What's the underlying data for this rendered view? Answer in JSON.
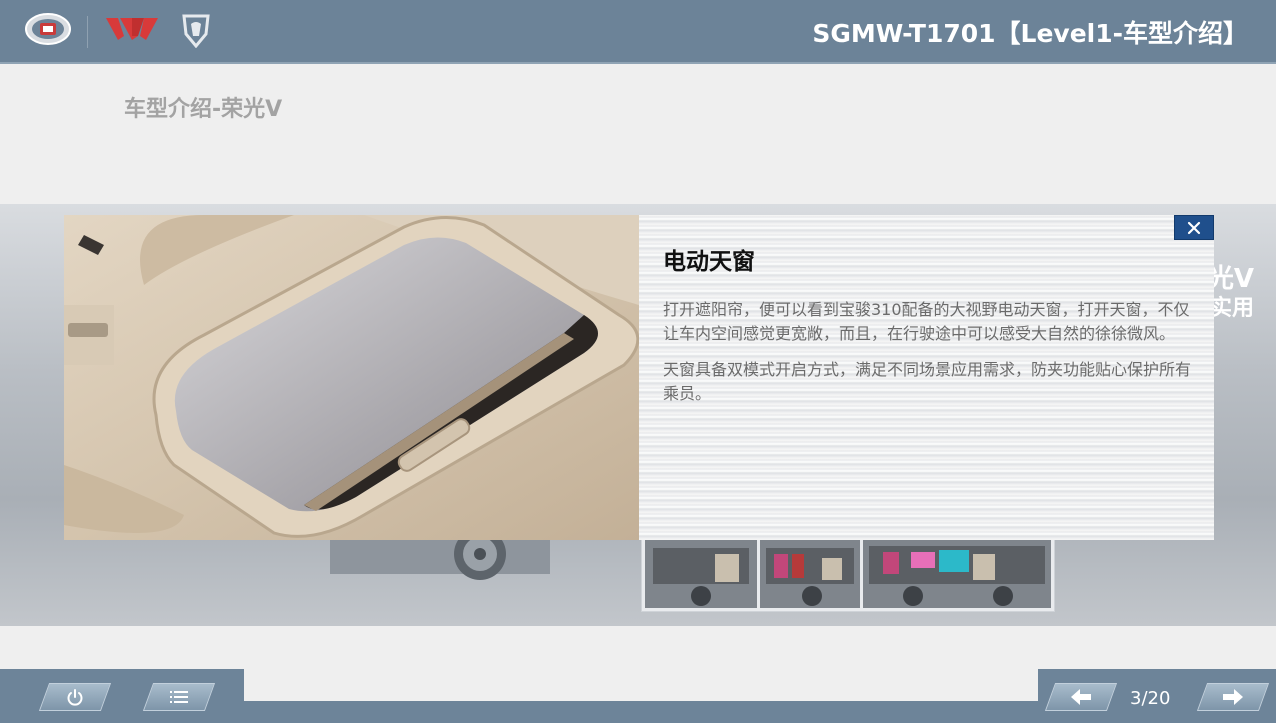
{
  "header": {
    "course_title": "SGMW-T1701【Level1-车型介绍】",
    "logos": [
      "sgmw-logo",
      "wuling-logo",
      "baojun-logo"
    ]
  },
  "page": {
    "heading": "车型介绍-荣光V"
  },
  "background_slide": {
    "side_text_1": "光V",
    "side_text_2": "实用"
  },
  "popup": {
    "title": "电动天窗",
    "paragraphs": [
      "打开遮阳帘，便可以看到宝骏310配备的大视野电动天窗，打开天窗，不仅让车内空间感觉更宽敞，而且，在行驶途中可以感受大自然的徐徐微风。",
      "天窗具备双模式开启方式，满足不同场景应用需求，防夹功能贴心保护所有乘员。"
    ],
    "close_icon": "close-icon"
  },
  "footer": {
    "page_indicator": "3/20",
    "current_page": 3,
    "total_pages": 20,
    "icons": [
      "power-icon",
      "menu-icon",
      "arrow-left-icon",
      "arrow-right-icon"
    ]
  },
  "colors": {
    "header_bar": "#6c8398",
    "close_button": "#1f4f8c",
    "background": "#efefef"
  }
}
